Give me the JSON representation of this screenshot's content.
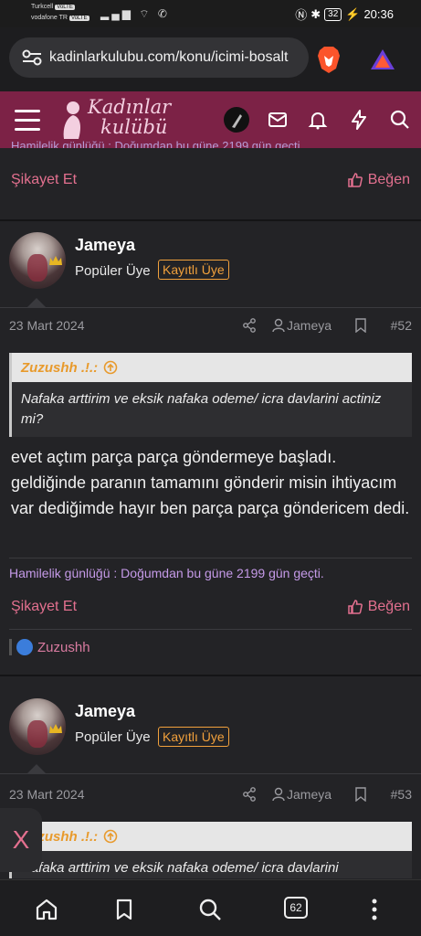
{
  "status_bar": {
    "carrier1": "Turkcell",
    "carrier1_tag": "VoLTE",
    "carrier2": "vodafone TR",
    "carrier2_tag": "VoLTE",
    "battery": "32",
    "time": "20:36"
  },
  "browser": {
    "url": "kadinlarkulubu.com/konu/icimi-bosalt",
    "tab_count": "62"
  },
  "site": {
    "logo_line1": "Kadınlar",
    "logo_line2": "kulübü"
  },
  "previous_post": {
    "signature_partial": "Hamilelik günlüğü : Doğumdan bu güne 2199 gün geçti.",
    "report_label": "Şikayet Et",
    "like_label": "Beğen"
  },
  "posts": [
    {
      "username": "Jameya",
      "user_title": "Popüler Üye",
      "badge": "Kayıtlı Üye",
      "date": "23 Mart 2024",
      "meta_user": "Jameya",
      "number": "#52",
      "quote_author": "Zuzushh .!.:",
      "quote_text": "Nafaka arttirim ve eksik nafaka odeme/ icra davlarini actiniz mi?",
      "text": "evet açtım parça parça göndermeye başladı. geldiğinde paranın tamamını gönderir misin ihtiyacım var dediğimde hayır ben parça parça göndericem dedi.",
      "signature": "Hamilelik günlüğü : Doğumdan bu güne 2199 gün geçti.",
      "report_label": "Şikayet Et",
      "like_label": "Beğen",
      "reaction_user": "Zuzushh"
    },
    {
      "username": "Jameya",
      "user_title": "Popüler Üye",
      "badge": "Kayıtlı Üye",
      "date": "23 Mart 2024",
      "meta_user": "Jameya",
      "number": "#53",
      "quote_author": "Zuzushh .!.:",
      "quote_text": "Nafaka arttirim ve eksik nafaka odeme/ icra davlarini"
    }
  ],
  "floating": {
    "close_label": "X"
  },
  "colors": {
    "header": "#7c2246",
    "accent": "#e3708f",
    "badge": "#f2a13c"
  },
  "icons": [
    "tune-icon",
    "brave-lion-icon",
    "triangle-icon",
    "menu-icon",
    "feather-icon",
    "mail-icon",
    "bell-icon",
    "bolt-icon",
    "search-icon",
    "share-icon",
    "user-icon",
    "bookmark-icon",
    "thumbs-up-icon",
    "home-icon"
  ]
}
